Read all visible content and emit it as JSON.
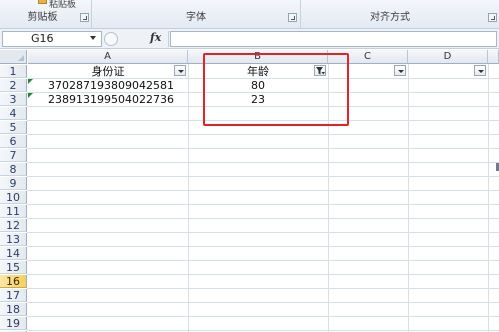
{
  "ribbon": {
    "paste_stub": "粘贴板",
    "groups": [
      {
        "label": "剪贴板"
      },
      {
        "label": "字体"
      },
      {
        "label": "对齐方式"
      }
    ]
  },
  "formula_bar": {
    "name_box": "G16",
    "fx_label": "fx",
    "formula": ""
  },
  "columns": [
    "A",
    "B",
    "C",
    "D"
  ],
  "rows": [
    "1",
    "2",
    "3",
    "4",
    "5",
    "6",
    "7",
    "8",
    "9",
    "10",
    "11",
    "12",
    "13",
    "14",
    "15",
    "16",
    "17",
    "18",
    "19",
    "20"
  ],
  "selected_row": "16",
  "cells": {
    "A1": "身份证",
    "B1": "年龄",
    "A2": "370287193809042581",
    "B2": "80",
    "A3": "238913199504022736",
    "B3": "23"
  },
  "colors": {
    "highlight_box": "#e0252a",
    "selected_row_header": "#f6cf5d",
    "error_indicator": "#1e8a3a"
  }
}
